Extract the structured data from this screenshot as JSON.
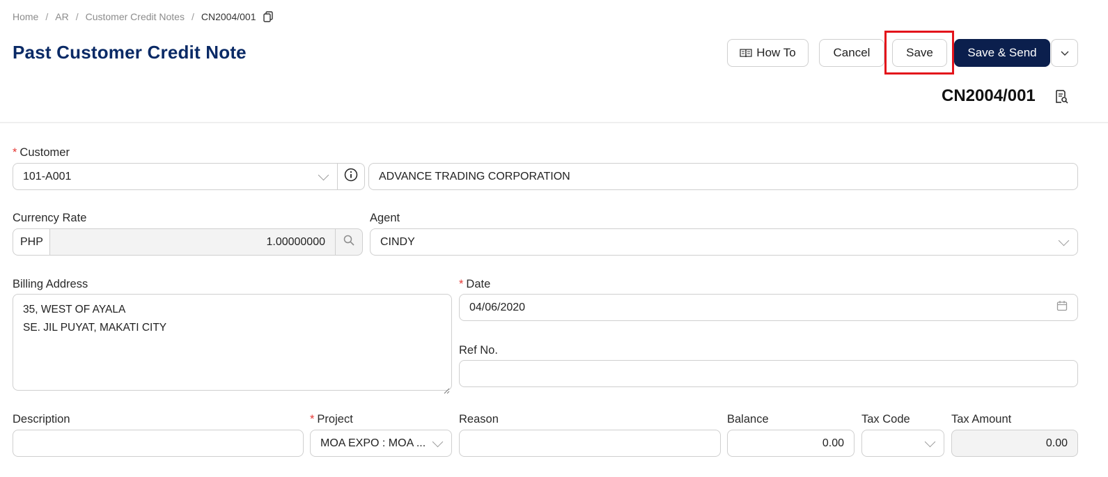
{
  "breadcrumb": {
    "items": [
      "Home",
      "AR",
      "Customer Credit Notes"
    ],
    "current": "CN2004/001",
    "separator": "/"
  },
  "header": {
    "title": "Past Customer Credit Note",
    "doc_number": "CN2004/001"
  },
  "toolbar": {
    "howto_label": "How To",
    "cancel_label": "Cancel",
    "save_label": "Save",
    "save_send_label": "Save & Send"
  },
  "form": {
    "customer": {
      "label": "Customer",
      "code": "101-A001",
      "name": "ADVANCE TRADING CORPORATION"
    },
    "currency": {
      "label": "Currency Rate",
      "code": "PHP",
      "rate": "1.00000000"
    },
    "agent": {
      "label": "Agent",
      "value": "CINDY"
    },
    "billing": {
      "label": "Billing Address",
      "line1": "35, WEST OF AYALA",
      "line2": "SE. JIL PUYAT, MAKATI CITY"
    },
    "date": {
      "label": "Date",
      "value": "04/06/2020"
    },
    "ref": {
      "label": "Ref No.",
      "value": ""
    },
    "line": {
      "description_label": "Description",
      "project_label": "Project",
      "project_value": "MOA EXPO : MOA ...",
      "reason_label": "Reason",
      "balance_label": "Balance",
      "balance_value": "0.00",
      "taxcode_label": "Tax Code",
      "taxamount_label": "Tax Amount",
      "taxamount_value": "0.00"
    }
  },
  "colors": {
    "title": "#0a2a66",
    "primary": "#0b1f4d",
    "highlight": "#e3141b",
    "required": "#e53935"
  }
}
